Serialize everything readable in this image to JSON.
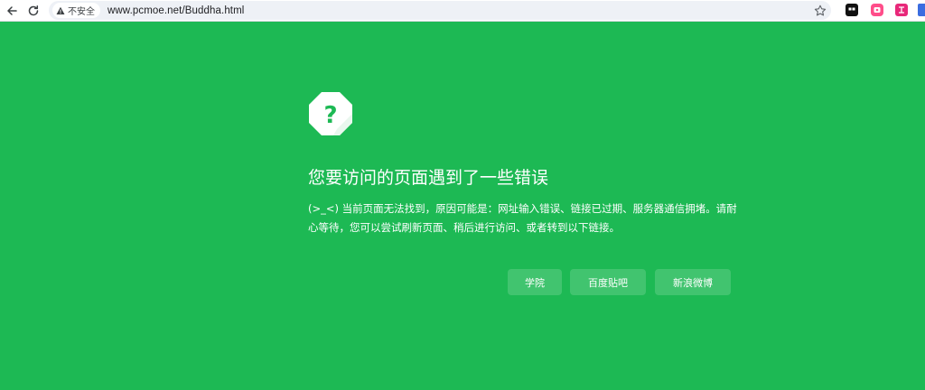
{
  "browser": {
    "security_label": "不安全",
    "url": "www.pcmoe.net/Buddha.html"
  },
  "error": {
    "title": "您要访问的页面遇到了一些错误",
    "description": "(>_<) 当前页面无法找到，原因可能是：网址输入错误、链接已过期、服务器通信拥堵。请耐心等待，您可以尝试刷新页面、稍后进行访问、或者转到以下链接。",
    "links": [
      {
        "label": "学院"
      },
      {
        "label": "百度贴吧"
      },
      {
        "label": "新浪微博"
      }
    ]
  },
  "colors": {
    "page_background": "#1db954",
    "icon_fill": "#ffffff",
    "icon_symbol": "#1db954"
  }
}
